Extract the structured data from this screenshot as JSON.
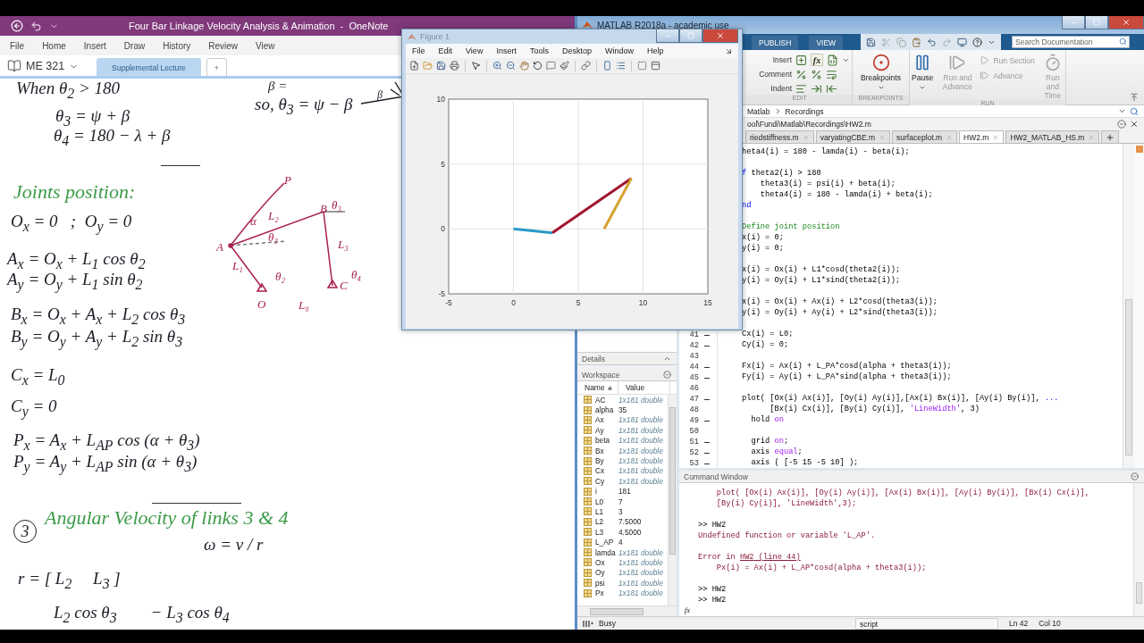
{
  "onenote": {
    "title": "Four Bar Linkage Velocity Analysis & Animation  -  OneNote",
    "menu": [
      "File",
      "Home",
      "Insert",
      "Draw",
      "History",
      "Review",
      "View"
    ],
    "notebook": "ME 321",
    "sections": [
      {
        "label": "Supplemental Lecture",
        "selected": true
      },
      {
        "label": "+",
        "selected": false
      }
    ],
    "ink": [
      {
        "kind": "text",
        "text": "When θ$_{2}$ > 180",
        "color": "#1e1e28"
      },
      {
        "kind": "text",
        "text": "θ$_{3}$ = ψ + β",
        "color": "#1e1e28"
      },
      {
        "kind": "text",
        "text": "θ$_{4}$ = 180 − λ + β",
        "color": "#1e1e28"
      },
      {
        "kind": "text",
        "text": "so, θ$_{3}$ = ψ − β",
        "color": "#1e1e28"
      },
      {
        "kind": "text",
        "text": "β =",
        "color": "#1e1e28"
      },
      {
        "kind": "heading",
        "text": "Joints position:",
        "color": "#3b9b48"
      },
      {
        "kind": "text",
        "text": "O$_{x}$ = 0   ;  O$_{y}$ = 0",
        "color": "#1e1e28"
      },
      {
        "kind": "text",
        "text": "A$_{x}$ = O$_{x}$ + L$_{1}$ cos θ$_{2}$",
        "color": "#1e1e28"
      },
      {
        "kind": "text",
        "text": "A$_{y}$ = O$_{y}$ + L$_{1}$ sin θ$_{2}$",
        "color": "#1e1e28"
      },
      {
        "kind": "text",
        "text": "B$_{x}$ = O$_{x}$ + A$_{x}$ + L$_{2}$ cos θ$_{3}$",
        "color": "#1e1e28"
      },
      {
        "kind": "text",
        "text": "B$_{y}$ = O$_{y}$ + A$_{y}$ + L$_{2}$ sin θ$_{3}$",
        "color": "#1e1e28"
      },
      {
        "kind": "text",
        "text": "C$_{x}$ = L$_{0}$",
        "color": "#1e1e28"
      },
      {
        "kind": "text",
        "text": "C$_{y}$ = 0",
        "color": "#1e1e28"
      },
      {
        "kind": "text",
        "text": "P$_{x}$ = A$_{x}$ + L$_{AP}$ cos (α + θ$_{3}$)",
        "color": "#1e1e28"
      },
      {
        "kind": "text",
        "text": "P$_{y}$ = A$_{y}$ + L$_{AP}$ sin (α + θ$_{3}$)",
        "color": "#1e1e28"
      },
      {
        "kind": "circled",
        "text": "3",
        "color": "#1e1e28"
      },
      {
        "kind": "heading",
        "text": "Angular Velocity of links 3 & 4",
        "color": "#3b9b48"
      },
      {
        "kind": "text",
        "text": "ω = v / r",
        "color": "#1e1e28"
      },
      {
        "kind": "text",
        "text": "r = [ L$_{2}$     L$_{3}$ ]",
        "color": "#1e1e28"
      },
      {
        "kind": "text",
        "text": "L$_{2}$ cos θ$_{3}$        − L$_{3}$ cos θ$_{4}$",
        "color": "#1e1e28"
      }
    ],
    "diagram_labels": [
      "P",
      "L₂",
      "α",
      "B",
      "θ₃",
      "θ₃",
      "A",
      "L₃",
      "L₁",
      "θ₂",
      "θ₄",
      "O",
      "C",
      "L₀"
    ],
    "sketch_label": "β"
  },
  "matlab": {
    "title": "MATLAB R2018a - academic use",
    "toolstrip_tabs": [
      "PUBLISH",
      "VIEW"
    ],
    "search": {
      "placeholder": "Search Documentation"
    },
    "edit_rows": [
      {
        "label": "Insert",
        "icon_text": "fx"
      },
      {
        "label": "Comment"
      },
      {
        "label": "Indent"
      }
    ],
    "groups": [
      "EDIT",
      "BREAKPOINTS",
      "RUN"
    ],
    "breakpoints": {
      "label": "Breakpoints",
      "disabled": false
    },
    "run_buttons": [
      {
        "label": "Pause",
        "disabled": false
      },
      {
        "label": "Run and Advance",
        "disabled": true
      },
      {
        "label": "Run Section",
        "disabled": true
      },
      {
        "label": "Advance",
        "disabled": true
      },
      {
        "label": "Run and Time",
        "disabled": true
      }
    ],
    "address": [
      "Matlab",
      "Recordings"
    ],
    "path": "ool\\Fundi\\Matlab\\Recordings\\HW2.m",
    "file_tabs": [
      {
        "label": "riedstiffness.m",
        "selected": false
      },
      {
        "label": "varyatingCBE.m",
        "selected": false
      },
      {
        "label": "surfaceplot.m",
        "selected": false
      },
      {
        "label": "HW2.m",
        "selected": true
      },
      {
        "label": "HW2_MATLAB_HS.m",
        "selected": false
      }
    ],
    "editor_lines": [
      {
        "kind": "code",
        "segments": [
          {
            "text": "heta4(i) = 180 - lamda(i) - beta(i);",
            "kind": "plain"
          }
        ]
      },
      {
        "kind": "blank"
      },
      {
        "kind": "code",
        "segments": [
          {
            "text": "f",
            "kind": "keyword"
          },
          {
            "text": " theta2(i) > 180",
            "kind": "plain"
          }
        ]
      },
      {
        "kind": "code",
        "segments": [
          {
            "text": "    theta3(i) = psi(i) + beta(i);",
            "kind": "plain"
          }
        ]
      },
      {
        "kind": "code",
        "segments": [
          {
            "text": "    theta4(i) = 180 - lamda(i) + beta(i);",
            "kind": "plain"
          }
        ]
      },
      {
        "kind": "code",
        "segments": [
          {
            "text": "nd",
            "kind": "keyword"
          }
        ]
      },
      {
        "kind": "blank"
      },
      {
        "kind": "code",
        "segments": [
          {
            "text": "Define joint position",
            "kind": "comment"
          }
        ]
      },
      {
        "kind": "code",
        "segments": [
          {
            "text": "x(i) = 0;",
            "kind": "plain"
          }
        ]
      },
      {
        "kind": "code",
        "segments": [
          {
            "text": "y(i) = 0;",
            "kind": "plain"
          }
        ]
      },
      {
        "kind": "blank"
      },
      {
        "kind": "code",
        "segments": [
          {
            "text": "x(i) = Ox(i) + L1*cosd(theta2(i));",
            "kind": "plain"
          }
        ]
      },
      {
        "kind": "code",
        "segments": [
          {
            "text": "y(i) = Oy(i) + L1*sind(theta2(i));",
            "kind": "plain"
          }
        ]
      },
      {
        "kind": "blank"
      },
      {
        "kind": "code",
        "segments": [
          {
            "text": "x(i) = Ox(i) + Ax(i) + L2*cosd(theta3(i));",
            "kind": "plain"
          }
        ]
      },
      {
        "kind": "code",
        "segments": [
          {
            "text": "y(i) = Oy(i) + Ay(i) + L2*sind(theta3(i));",
            "kind": "plain"
          }
        ]
      },
      {
        "kind": "blank"
      },
      {
        "kind": "code",
        "number": "41",
        "executable": true,
        "segments": [
          {
            "text": "Cx(i) = L0;",
            "kind": "plain"
          }
        ]
      },
      {
        "kind": "code",
        "number": "42",
        "executable": true,
        "segments": [
          {
            "text": "Cy(i) = 0;",
            "kind": "plain"
          }
        ]
      },
      {
        "kind": "blank",
        "number": "43",
        "executable": false
      },
      {
        "kind": "code",
        "number": "44",
        "executable": true,
        "segments": [
          {
            "text": "Fx(i) = Ax(i) + L_PA*cosd(alpha + theta3(i));",
            "kind": "plain"
          }
        ]
      },
      {
        "kind": "code",
        "number": "45",
        "executable": true,
        "segments": [
          {
            "text": "Fy(i) = Ay(i) + L_PA*sind(alpha + theta3(i));",
            "kind": "plain"
          }
        ]
      },
      {
        "kind": "blank",
        "number": "46",
        "executable": false
      },
      {
        "kind": "code",
        "number": "47",
        "executable": true,
        "segments": [
          {
            "text": "plot( [Ox(i) Ax(i)], [Oy(i) Ay(i)],[Ax(i) Bx(i)], [Ay(i) By(i)], ",
            "kind": "plain"
          },
          {
            "text": "...",
            "kind": "keyword"
          }
        ]
      },
      {
        "kind": "code",
        "number": "48",
        "executable": false,
        "segments": [
          {
            "text": "      [Bx(i) Cx(i)], [By(i) Cy(i)], ",
            "kind": "plain"
          },
          {
            "text": "'LineWidth'",
            "kind": "string"
          },
          {
            "text": ", 3)",
            "kind": "plain"
          }
        ]
      },
      {
        "kind": "code",
        "number": "49",
        "executable": true,
        "segments": [
          {
            "text": "  hold ",
            "kind": "plain"
          },
          {
            "text": "on",
            "kind": "string"
          }
        ]
      },
      {
        "kind": "blank",
        "number": "50",
        "executable": false
      },
      {
        "kind": "code",
        "number": "51",
        "executable": true,
        "segments": [
          {
            "text": "  grid ",
            "kind": "plain"
          },
          {
            "text": "on",
            "kind": "string"
          },
          {
            "text": ";",
            "kind": "plain"
          }
        ]
      },
      {
        "kind": "code",
        "number": "52",
        "executable": true,
        "segments": [
          {
            "text": "  axis ",
            "kind": "plain"
          },
          {
            "text": "equal",
            "kind": "string"
          },
          {
            "text": ";",
            "kind": "plain"
          }
        ]
      },
      {
        "kind": "code",
        "number": "53",
        "executable": true,
        "segments": [
          {
            "text": "  axis ( [-5 15 -5 10] );",
            "kind": "plain"
          }
        ]
      }
    ],
    "details": "Details",
    "workspace": {
      "title": "Workspace",
      "columns": [
        "Name",
        "Value"
      ],
      "rows": [
        {
          "name": "AC",
          "value": "1x181 double",
          "kind": "array"
        },
        {
          "name": "alpha",
          "value": "35",
          "kind": "scalar"
        },
        {
          "name": "Ax",
          "value": "1x181 double",
          "kind": "array"
        },
        {
          "name": "Ay",
          "value": "1x181 double",
          "kind": "array"
        },
        {
          "name": "beta",
          "value": "1x181 double",
          "kind": "array"
        },
        {
          "name": "Bx",
          "value": "1x181 double",
          "kind": "array"
        },
        {
          "name": "By",
          "value": "1x181 double",
          "kind": "array"
        },
        {
          "name": "Cx",
          "value": "1x181 double",
          "kind": "array"
        },
        {
          "name": "Cy",
          "value": "1x181 double",
          "kind": "array"
        },
        {
          "name": "i",
          "value": "181",
          "kind": "scalar"
        },
        {
          "name": "L0",
          "value": "7",
          "kind": "scalar"
        },
        {
          "name": "L1",
          "value": "3",
          "kind": "scalar"
        },
        {
          "name": "L2",
          "value": "7.5000",
          "kind": "scalar"
        },
        {
          "name": "L3",
          "value": "4.5000",
          "kind": "scalar"
        },
        {
          "name": "L_AP",
          "value": "4",
          "kind": "scalar"
        },
        {
          "name": "lamda",
          "value": "1x181 double",
          "kind": "array"
        },
        {
          "name": "Ox",
          "value": "1x181 double",
          "kind": "array"
        },
        {
          "name": "Oy",
          "value": "1x181 double",
          "kind": "array"
        },
        {
          "name": "psi",
          "value": "1x181 double",
          "kind": "array"
        },
        {
          "name": "Px",
          "value": "1x181 double",
          "kind": "array"
        }
      ]
    },
    "command_window": {
      "title": "Command Window",
      "prompt_icon": "fx",
      "lines": [
        {
          "kind": "text",
          "segments": [
            {
              "text": "    plot( [Ox(i) Ax(i)], [Oy(i) Ay(i)], [Ax(i) Bx(i)], [Ay(i) By(i)], [Bx(i) Cx(i)],",
              "kind": "error"
            }
          ]
        },
        {
          "kind": "text",
          "segments": [
            {
              "text": "    [By(i) Cy(i)], 'LineWidth',3);",
              "kind": "error"
            }
          ]
        },
        {
          "kind": "blank"
        },
        {
          "kind": "text",
          "segments": [
            {
              "text": ">> HW2",
              "kind": "plain"
            }
          ]
        },
        {
          "kind": "text",
          "segments": [
            {
              "text": "Undefined function or variable 'L_AP'.",
              "kind": "error"
            }
          ]
        },
        {
          "kind": "blank"
        },
        {
          "kind": "text",
          "segments": [
            {
              "text": "Error in ",
              "kind": "error"
            },
            {
              "text": "HW2",
              "kind": "link"
            },
            {
              "text": " (line 44)",
              "kind": "link"
            }
          ]
        },
        {
          "kind": "text",
          "segments": [
            {
              "text": "    Px(i) = Ax(i) + L_AP*cosd(alpha + theta3(i));",
              "kind": "error"
            }
          ]
        },
        {
          "kind": "blank"
        },
        {
          "kind": "text",
          "segments": [
            {
              "text": ">> HW2",
              "kind": "plain"
            }
          ]
        },
        {
          "kind": "text",
          "segments": [
            {
              "text": ">> HW2",
              "kind": "plain"
            }
          ]
        }
      ]
    },
    "status": {
      "state": "Busy",
      "mode": "script",
      "line": "Ln 42",
      "column": "Col 10"
    }
  },
  "figure": {
    "title": "Figure 1",
    "menu": [
      "File",
      "Edit",
      "View",
      "Insert",
      "Tools",
      "Desktop",
      "Window",
      "Help"
    ],
    "chart_data": {
      "type": "line",
      "grid": true,
      "xlim": [
        -5,
        15
      ],
      "ylim": [
        -5,
        10
      ],
      "xticks": [
        -5,
        0,
        5,
        10,
        15
      ],
      "yticks": [
        -5,
        0,
        5,
        10
      ],
      "series": [
        {
          "color": "#2a9ac8",
          "x": [
            0,
            3
          ],
          "values": [
            0,
            -0.3
          ]
        },
        {
          "color": "#a2142f",
          "x": [
            3,
            9.1
          ],
          "values": [
            -0.3,
            3.9
          ]
        },
        {
          "color": "#d6a12f",
          "x": [
            9.1,
            7
          ],
          "values": [
            3.9,
            0
          ]
        }
      ]
    }
  }
}
